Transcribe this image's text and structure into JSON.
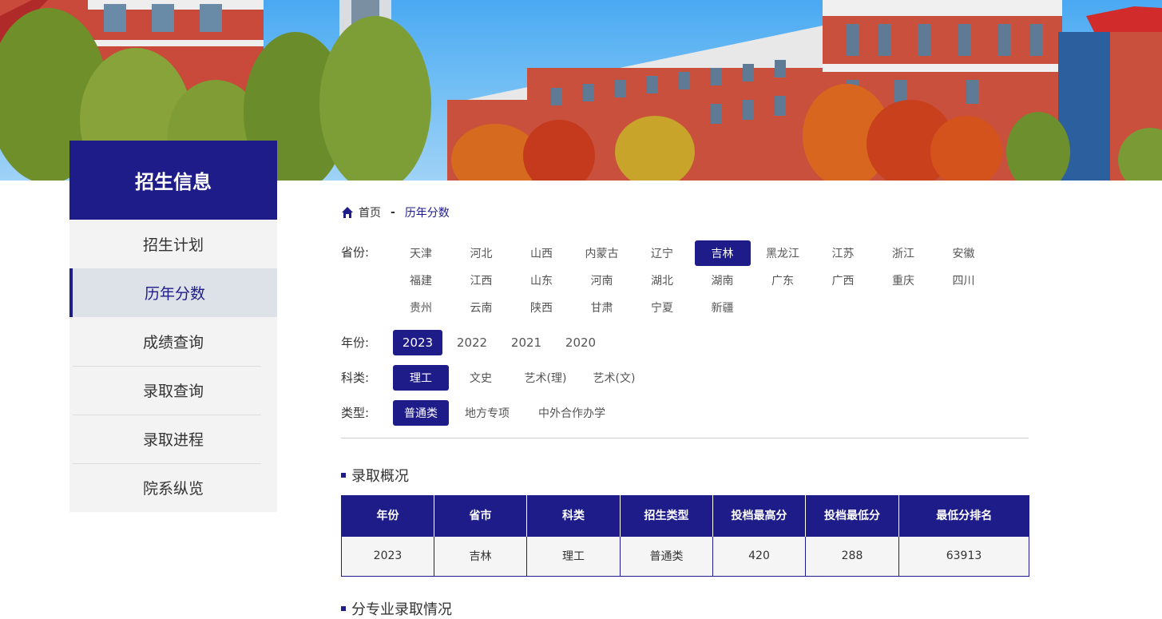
{
  "sidebar": {
    "title": "招生信息",
    "items": [
      {
        "label": "招生计划"
      },
      {
        "label": "历年分数"
      },
      {
        "label": "成绩查询"
      },
      {
        "label": "录取查询"
      },
      {
        "label": "录取进程"
      },
      {
        "label": "院系纵览"
      }
    ],
    "active_index": 1
  },
  "breadcrumb": {
    "home": "首页",
    "separator": "-",
    "current": "历年分数"
  },
  "filters": {
    "province": {
      "label": "省份:",
      "options": [
        "天津",
        "河北",
        "山西",
        "内蒙古",
        "辽宁",
        "吉林",
        "黑龙江",
        "江苏",
        "浙江",
        "安徽",
        "福建",
        "江西",
        "山东",
        "河南",
        "湖北",
        "湖南",
        "广东",
        "广西",
        "重庆",
        "四川",
        "贵州",
        "云南",
        "陕西",
        "甘肃",
        "宁夏",
        "新疆"
      ],
      "selected": "吉林"
    },
    "year": {
      "label": "年份:",
      "options": [
        "2023",
        "2022",
        "2021",
        "2020"
      ],
      "selected": "2023"
    },
    "subject": {
      "label": "科类:",
      "options": [
        "理工",
        "文史",
        "艺术(理)",
        "艺术(文)"
      ],
      "selected": "理工"
    },
    "type": {
      "label": "类型:",
      "options": [
        "普通类",
        "地方专项",
        "中外合作办学"
      ],
      "selected": "普通类"
    }
  },
  "summary": {
    "title": "录取概况",
    "columns": [
      "年份",
      "省市",
      "科类",
      "招生类型",
      "投档最高分",
      "投档最低分",
      "最低分排名"
    ],
    "rows": [
      [
        "2023",
        "吉林",
        "理工",
        "普通类",
        "420",
        "288",
        "63913"
      ]
    ]
  },
  "major_section": {
    "title": "分专业录取情况"
  },
  "colors": {
    "primary": "#1e1c88",
    "sidebar_bg": "#f3f3f3",
    "sidebar_active_bg": "#dde1e8"
  }
}
